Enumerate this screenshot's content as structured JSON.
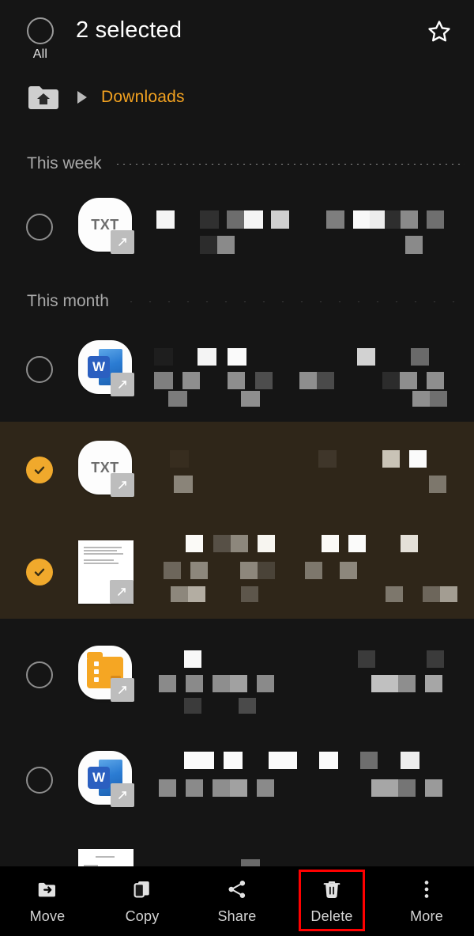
{
  "app": {
    "background": "#151515",
    "accent": "#f3a220",
    "selected_row_bg": "#2f2619",
    "highlight_color": "#ff0000"
  },
  "header": {
    "title": "2 selected",
    "select_all_label": "All",
    "select_all_state": "unchecked",
    "favorite_icon": "star-outline-icon"
  },
  "breadcrumb": {
    "home_icon": "home-folder-icon",
    "separator_icon": "caret-right-icon",
    "current": "Downloads"
  },
  "sections": [
    {
      "label": "This week",
      "divider": "dotted"
    },
    {
      "label": "This month",
      "divider": "dotted-sparse"
    }
  ],
  "rows": [
    {
      "id": "row-1",
      "section": "This week",
      "icon": "txt-file-icon",
      "icon_label": "TXT",
      "selected": false,
      "filename": "[redacted]"
    },
    {
      "id": "row-2",
      "section": "This month",
      "icon": "word-file-icon",
      "icon_label": "W",
      "selected": false,
      "filename": "[redacted]"
    },
    {
      "id": "row-3",
      "section": "This month",
      "icon": "txt-file-icon",
      "icon_label": "TXT",
      "selected": true,
      "filename": "[redacted]"
    },
    {
      "id": "row-4",
      "section": "This month",
      "icon": "document-thumbnail",
      "icon_label": "",
      "selected": true,
      "filename": "[redacted]"
    },
    {
      "id": "row-5",
      "section": "This month",
      "icon": "zip-folder-icon",
      "icon_label": "",
      "selected": false,
      "filename": "[redacted]"
    },
    {
      "id": "row-6",
      "section": "This month",
      "icon": "word-file-icon",
      "icon_label": "W",
      "selected": false,
      "filename": "[redacted]"
    },
    {
      "id": "row-7",
      "section": "This month",
      "icon": "document-thumbnail",
      "icon_label": "",
      "selected": false,
      "filename": "[redacted]"
    }
  ],
  "toolbar": {
    "items": [
      {
        "label": "Move",
        "icon": "move-to-folder-icon",
        "highlighted": false
      },
      {
        "label": "Copy",
        "icon": "copy-icon",
        "highlighted": false
      },
      {
        "label": "Share",
        "icon": "share-icon",
        "highlighted": false
      },
      {
        "label": "Delete",
        "icon": "trash-icon",
        "highlighted": true
      },
      {
        "label": "More",
        "icon": "more-vertical-icon",
        "highlighted": false
      }
    ]
  }
}
